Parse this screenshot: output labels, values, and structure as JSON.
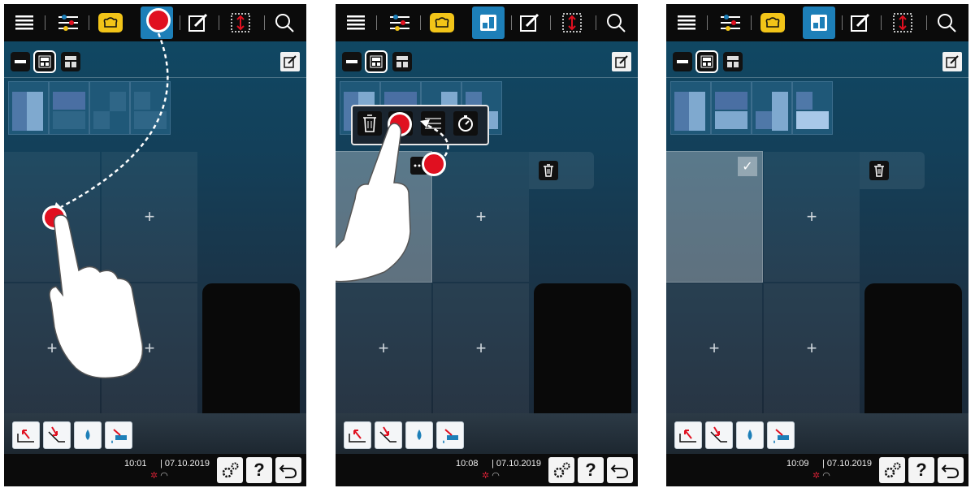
{
  "screens": [
    {
      "time": "10:01",
      "date": "| 07.10.2019"
    },
    {
      "time": "10:08",
      "date": "| 07.10.2019"
    },
    {
      "time": "10:09",
      "date": "| 07.10.2019"
    }
  ],
  "icons": {
    "topbar": [
      "menu-icon",
      "settings-sliders-icon",
      "cooking-mode-icon",
      "layout-view-icon",
      "edit-icon",
      "resize-icon",
      "search-icon"
    ],
    "actions": [
      "unload-icon",
      "load-icon",
      "water-icon",
      "clean-icon"
    ],
    "bottom": [
      "settings-gear-icon",
      "help-icon",
      "back-icon"
    ],
    "popup": [
      "trash-icon",
      "tray-icon",
      "settings-sliders-icon",
      "timer-icon"
    ]
  },
  "labels": {
    "help": "?",
    "plus": "+",
    "check": "✓"
  },
  "colors": {
    "accent": "#1d7fb8",
    "tap": "#e01020",
    "cook_mode": "#f2c418"
  }
}
